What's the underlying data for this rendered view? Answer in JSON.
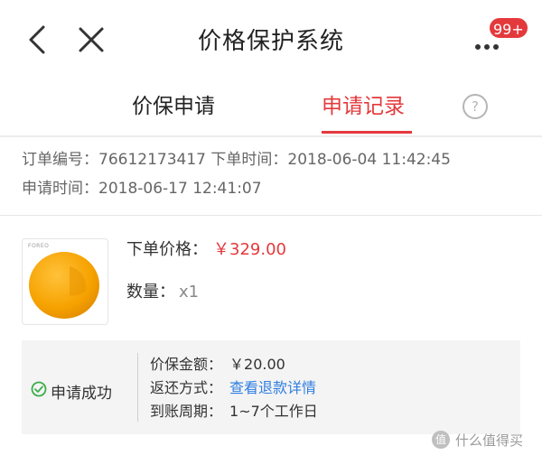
{
  "nav": {
    "title": "价格保护系统",
    "badge": "99+"
  },
  "tabs": {
    "apply": "价保申请",
    "records": "申请记录",
    "help_symbol": "?"
  },
  "order": {
    "order_no_label": "订单编号：",
    "order_no": "76612173417",
    "order_time_label": "下单时间：",
    "order_time": "2018-06-04 11:42:45",
    "apply_time_label": "申请时间：",
    "apply_time": "2018-06-17 12:41:07"
  },
  "product": {
    "brand": "FOREO",
    "price_label": "下单价格：",
    "price": "￥329.00",
    "qty_label": "数量：",
    "qty": "x1"
  },
  "refund": {
    "status": "申请成功",
    "amount_label": "价保金额：",
    "amount": "￥20.00",
    "method_label": "返还方式：",
    "method_link": "查看退款详情",
    "period_label": "到账周期：",
    "period": "1~7个工作日"
  },
  "watermark": {
    "logo": "值",
    "text": "什么值得买"
  },
  "colors": {
    "accent_red": "#e4393c",
    "link_blue": "#2f7ee0",
    "success_green": "#3cae48",
    "product_yellow": "#f6a200"
  }
}
